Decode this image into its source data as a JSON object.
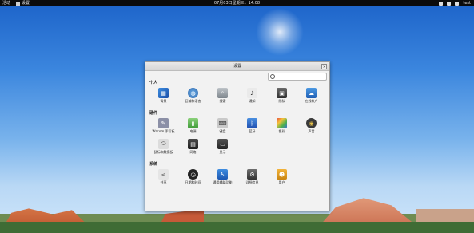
{
  "topbar": {
    "activities": "活动",
    "app_name": "设置",
    "clock": "07月03日星期三，14:08",
    "user": "test"
  },
  "window": {
    "title": "设置",
    "search_placeholder": ""
  },
  "sections": {
    "personal": {
      "title": "个人",
      "items": [
        {
          "label": "背景",
          "icon": "background-icon"
        },
        {
          "label": "区域和语言",
          "icon": "globe-icon"
        },
        {
          "label": "搜索",
          "icon": "search-icon"
        },
        {
          "label": "通知",
          "icon": "bell-icon"
        },
        {
          "label": "隐私",
          "icon": "privacy-icon"
        },
        {
          "label": "在线帐户",
          "icon": "accounts-icon"
        }
      ]
    },
    "hardware": {
      "title": "硬件",
      "items": [
        {
          "label": "Wacom 手写板",
          "icon": "wacom-icon"
        },
        {
          "label": "电源",
          "icon": "power-icon"
        },
        {
          "label": "键盘",
          "icon": "keyboard-icon"
        },
        {
          "label": "蓝牙",
          "icon": "bluetooth-icon"
        },
        {
          "label": "色彩",
          "icon": "color-icon"
        },
        {
          "label": "声音",
          "icon": "sound-icon"
        },
        {
          "label": "鼠标和触摸板",
          "icon": "mouse-icon"
        },
        {
          "label": "网络",
          "icon": "network-icon"
        },
        {
          "label": "显示",
          "icon": "display-icon"
        }
      ]
    },
    "system": {
      "title": "系统",
      "items": [
        {
          "label": "共享",
          "icon": "share-icon"
        },
        {
          "label": "日期和时间",
          "icon": "clock-icon"
        },
        {
          "label": "通用辅助功能",
          "icon": "accessibility-icon"
        },
        {
          "label": "详细信息",
          "icon": "info-icon"
        },
        {
          "label": "用户",
          "icon": "users-icon"
        }
      ]
    }
  }
}
